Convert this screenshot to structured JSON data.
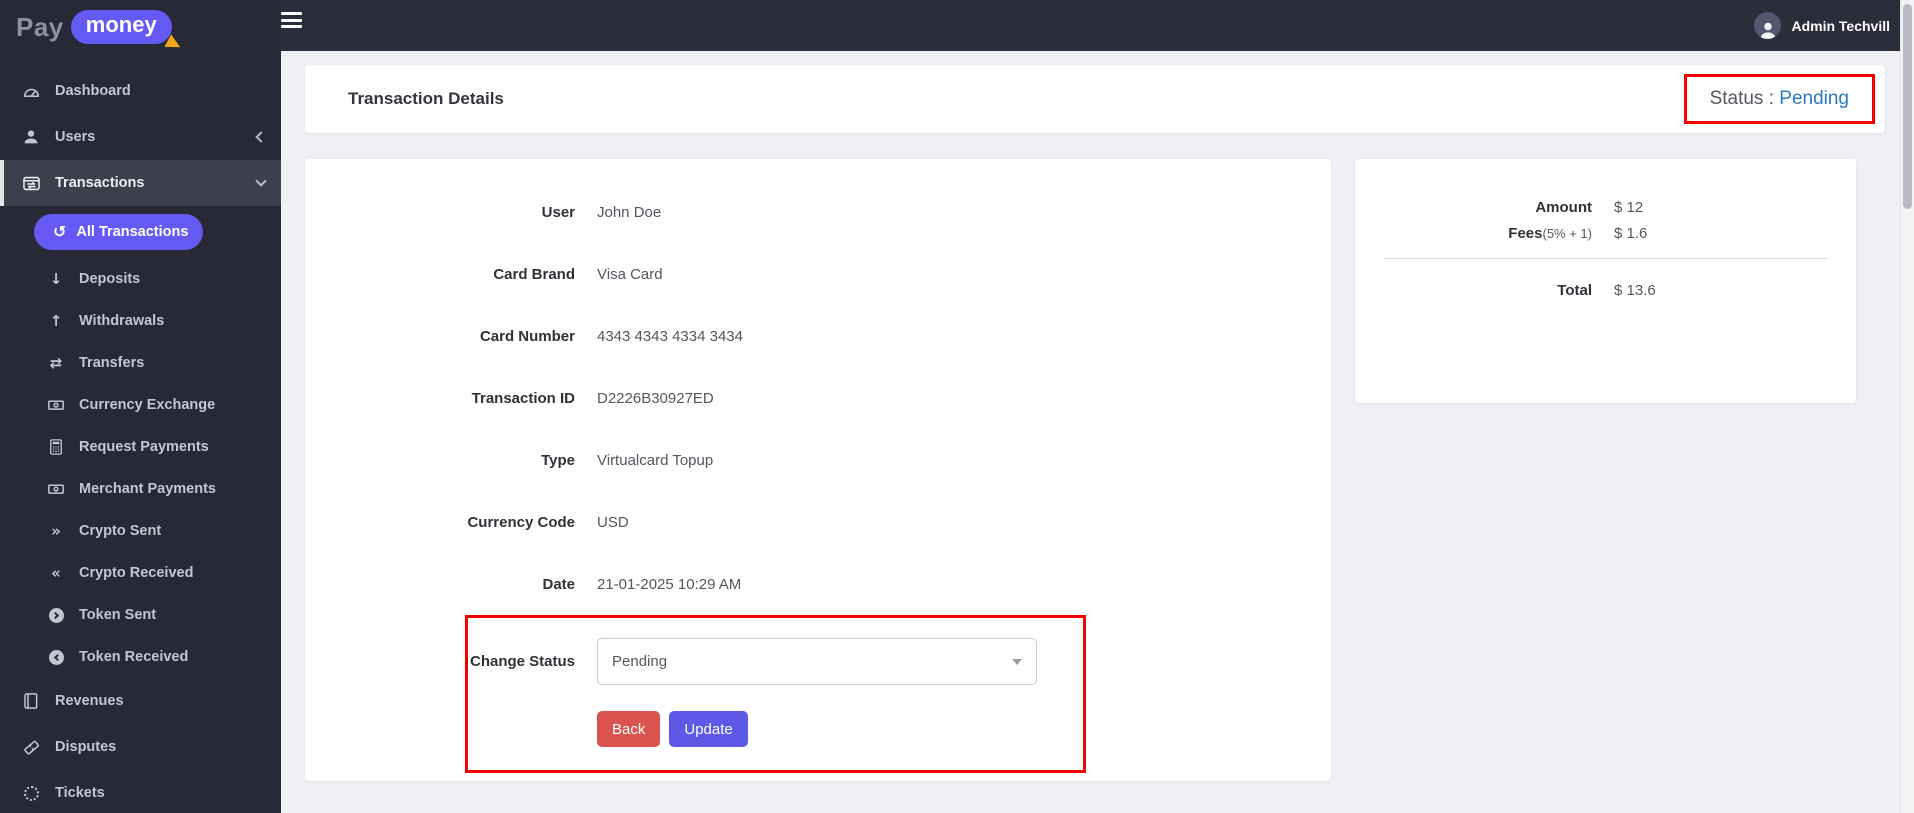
{
  "brand": {
    "pay": "Pay",
    "money": "money"
  },
  "topbar": {
    "admin_name": "Admin Techvill"
  },
  "sidebar": {
    "items": [
      {
        "label": "Dashboard"
      },
      {
        "label": "Users"
      },
      {
        "label": "Transactions"
      },
      {
        "label": "All Transactions"
      },
      {
        "label": "Deposits"
      },
      {
        "label": "Withdrawals"
      },
      {
        "label": "Transfers"
      },
      {
        "label": "Currency Exchange"
      },
      {
        "label": "Request Payments"
      },
      {
        "label": "Merchant Payments"
      },
      {
        "label": "Crypto Sent"
      },
      {
        "label": "Crypto Received"
      },
      {
        "label": "Token Sent"
      },
      {
        "label": "Token Received"
      },
      {
        "label": "Revenues"
      },
      {
        "label": "Disputes"
      },
      {
        "label": "Tickets"
      }
    ]
  },
  "header": {
    "title": "Transaction Details",
    "status_label": "Status :",
    "status_value": "Pending"
  },
  "details": {
    "rows": [
      {
        "label": "User",
        "value": "John Doe"
      },
      {
        "label": "Card Brand",
        "value": "Visa Card"
      },
      {
        "label": "Card Number",
        "value": "4343 4343 4334 3434"
      },
      {
        "label": "Transaction ID",
        "value": "D2226B30927ED"
      },
      {
        "label": "Type",
        "value": "Virtualcard Topup"
      },
      {
        "label": "Currency Code",
        "value": "USD"
      },
      {
        "label": "Date",
        "value": "21-01-2025 10:29 AM"
      }
    ],
    "change_status": {
      "label": "Change Status",
      "selected": "Pending",
      "back": "Back",
      "update": "Update"
    }
  },
  "summary": {
    "amount_label": "Amount",
    "amount_value": "$ 12",
    "fees_label": "Fees",
    "fees_note": "(5% + 1)",
    "fees_value": "$ 1.6",
    "total_label": "Total",
    "total_value": "$ 13.6"
  },
  "colors": {
    "accent": "#6459f2",
    "danger": "#d9534f",
    "status_blue": "#2a7bbd",
    "highlight_red": "#f30000"
  }
}
